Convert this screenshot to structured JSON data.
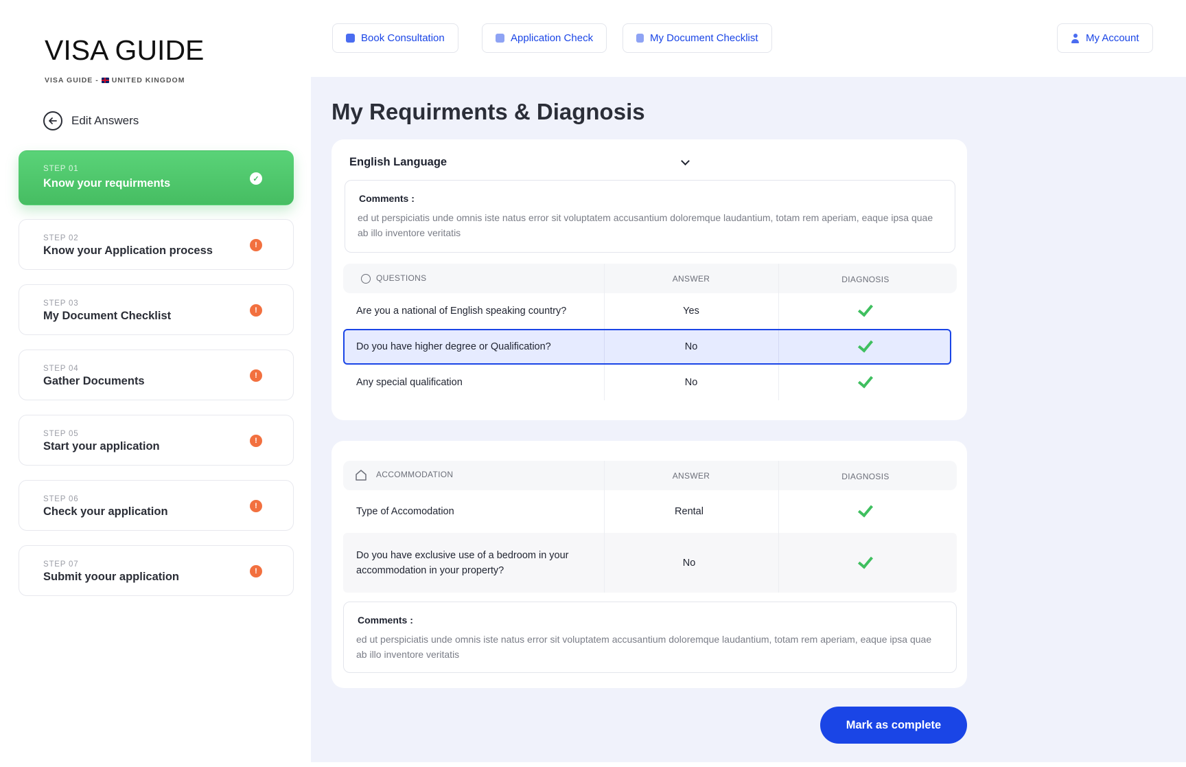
{
  "brand": {
    "title": "VISA GUIDE",
    "subtitle_left": "VISA GUIDE -",
    "subtitle_right": "UNITED KINGDOM"
  },
  "sidebar": {
    "edit_answers": "Edit Answers",
    "steps": [
      {
        "num": "STEP 01",
        "label": "Know your requirments",
        "status": "complete"
      },
      {
        "num": "STEP 02",
        "label": "Know your Application process",
        "status": "pending"
      },
      {
        "num": "STEP 03",
        "label": "My Document Checklist",
        "status": "pending"
      },
      {
        "num": "STEP 04",
        "label": "Gather Documents",
        "status": "pending"
      },
      {
        "num": "STEP 05",
        "label": "Start your application",
        "status": "pending"
      },
      {
        "num": "STEP 06",
        "label": "Check your application",
        "status": "pending"
      },
      {
        "num": "STEP 07",
        "label": "Submit yoour application",
        "status": "pending"
      }
    ],
    "pending_badge": "!",
    "complete_badge": "✓"
  },
  "topnav": {
    "book": "Book Consultation",
    "check": "Application Check",
    "checklist": "My Document Checklist",
    "account": "My Account"
  },
  "main": {
    "title": "My Requirments & Diagnosis",
    "english": {
      "section": "English Language",
      "comments_title": "Comments :",
      "comments_body": "ed ut perspiciatis unde omnis iste natus error sit voluptatem accusantium doloremque laudantium, totam rem aperiam, eaque ipsa quae ab illo inventore veritatis",
      "headers": {
        "q": "QUESTIONS",
        "a": "ANSWER",
        "d": "DIAGNOSIS"
      },
      "rows": [
        {
          "q": "Are you a national of English speaking country?",
          "a": "Yes"
        },
        {
          "q": "Do you have higher degree or Qualification?",
          "a": "No"
        },
        {
          "q": "Any special qualification",
          "a": "No"
        }
      ]
    },
    "accommodation": {
      "headers": {
        "q": "ACCOMMODATION",
        "a": "ANSWER",
        "d": "DIAGNOSIS"
      },
      "rows": [
        {
          "q": "Type of Accomodation",
          "a": "Rental"
        },
        {
          "q": "Do you have exclusive use of a bedroom in your accommodation in your property?",
          "a": "No"
        }
      ],
      "comments_title": "Comments :",
      "comments_body": "ed ut perspiciatis unde omnis iste natus error sit voluptatem accusantium doloremque laudantium, totam rem aperiam, eaque ipsa quae ab illo inventore veritatis"
    },
    "complete_button": "Mark as complete"
  },
  "colors": {
    "accent": "#1a45e6",
    "success": "#46bd62",
    "warning": "#f2703f",
    "background": "#f0f2fb"
  }
}
